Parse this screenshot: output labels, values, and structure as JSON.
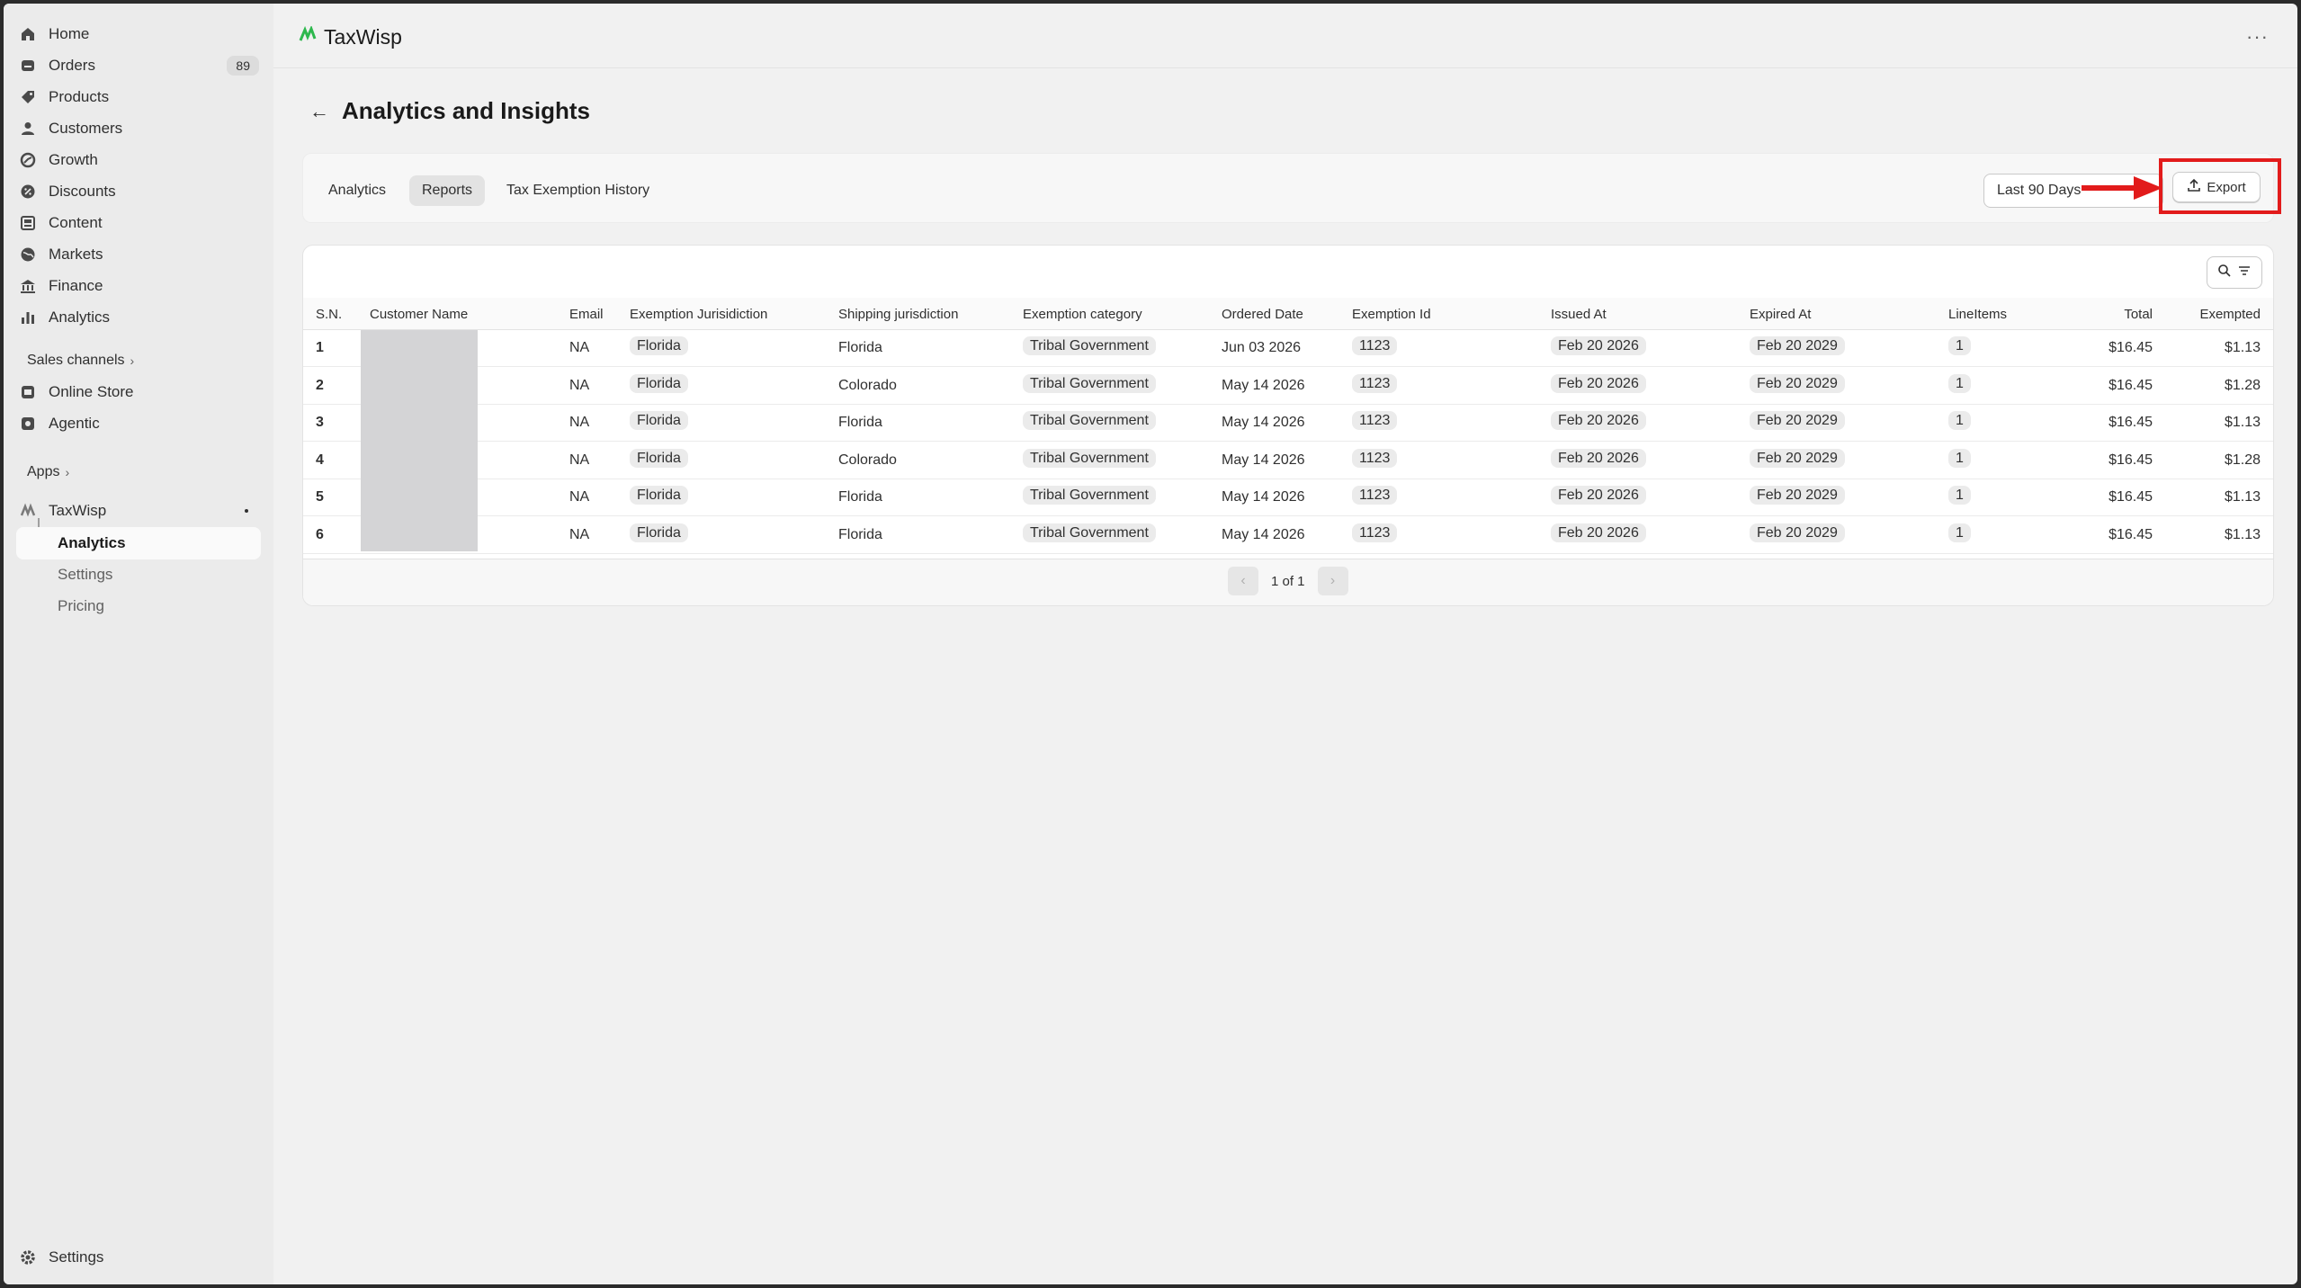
{
  "sidebar": {
    "items": [
      {
        "label": "Home",
        "icon": "home-icon"
      },
      {
        "label": "Orders",
        "icon": "orders-icon",
        "count": "89"
      },
      {
        "label": "Products",
        "icon": "tag-icon"
      },
      {
        "label": "Customers",
        "icon": "person-icon"
      },
      {
        "label": "Growth",
        "icon": "growth-icon"
      },
      {
        "label": "Discounts",
        "icon": "discount-icon"
      },
      {
        "label": "Content",
        "icon": "content-icon"
      },
      {
        "label": "Markets",
        "icon": "globe-icon"
      },
      {
        "label": "Finance",
        "icon": "bank-icon"
      },
      {
        "label": "Analytics",
        "icon": "bar-chart-icon"
      }
    ],
    "sales_channels_label": "Sales channels",
    "channels": [
      {
        "label": "Online Store",
        "icon": "store-icon"
      },
      {
        "label": "Agentic",
        "icon": "agentic-icon"
      }
    ],
    "apps_label": "Apps",
    "app_name": "TaxWisp",
    "app_subitems": [
      "Analytics",
      "Settings",
      "Pricing"
    ],
    "settings_label": "Settings"
  },
  "header": {
    "brand": "TaxWisp",
    "more_label": "···"
  },
  "page": {
    "title": "Analytics and Insights",
    "tabs": [
      "Analytics",
      "Reports",
      "Tax Exemption History"
    ],
    "active_tab": "Reports",
    "date_range": "Last 90 Days",
    "export_label": "Export"
  },
  "table": {
    "columns": [
      "S.N.",
      "Customer Name",
      "Email",
      "Exemption Jurisidiction",
      "Shipping jurisdiction",
      "Exemption category",
      "Ordered Date",
      "Exemption Id",
      "Issued At",
      "Expired At",
      "LineItems",
      "Total",
      "Exempted"
    ],
    "rows": [
      {
        "sn": "1",
        "email": "NA",
        "exemption_jurisdiction": "Florida",
        "shipping": "Florida",
        "category": "Tribal Government",
        "ordered": "Jun 03 2026",
        "exemption_id": "1123",
        "issued": "Feb 20 2026",
        "expired": "Feb 20 2029",
        "line_items": "1",
        "total": "$16.45",
        "exempted": "$1.13"
      },
      {
        "sn": "2",
        "email": "NA",
        "exemption_jurisdiction": "Florida",
        "shipping": "Colorado",
        "category": "Tribal Government",
        "ordered": "May 14 2026",
        "exemption_id": "1123",
        "issued": "Feb 20 2026",
        "expired": "Feb 20 2029",
        "line_items": "1",
        "total": "$16.45",
        "exempted": "$1.28"
      },
      {
        "sn": "3",
        "email": "NA",
        "exemption_jurisdiction": "Florida",
        "shipping": "Florida",
        "category": "Tribal Government",
        "ordered": "May 14 2026",
        "exemption_id": "1123",
        "issued": "Feb 20 2026",
        "expired": "Feb 20 2029",
        "line_items": "1",
        "total": "$16.45",
        "exempted": "$1.13"
      },
      {
        "sn": "4",
        "email": "NA",
        "exemption_jurisdiction": "Florida",
        "shipping": "Colorado",
        "category": "Tribal Government",
        "ordered": "May 14 2026",
        "exemption_id": "1123",
        "issued": "Feb 20 2026",
        "expired": "Feb 20 2029",
        "line_items": "1",
        "total": "$16.45",
        "exempted": "$1.28"
      },
      {
        "sn": "5",
        "email": "NA",
        "exemption_jurisdiction": "Florida",
        "shipping": "Florida",
        "category": "Tribal Government",
        "ordered": "May 14 2026",
        "exemption_id": "1123",
        "issued": "Feb 20 2026",
        "expired": "Feb 20 2029",
        "line_items": "1",
        "total": "$16.45",
        "exempted": "$1.13"
      },
      {
        "sn": "6",
        "email": "NA",
        "exemption_jurisdiction": "Florida",
        "shipping": "Florida",
        "category": "Tribal Government",
        "ordered": "May 14 2026",
        "exemption_id": "1123",
        "issued": "Feb 20 2026",
        "expired": "Feb 20 2029",
        "line_items": "1",
        "total": "$16.45",
        "exempted": "$1.13"
      }
    ],
    "pagination": "1 of 1"
  },
  "colors": {
    "highlight": "#e21b1b",
    "brand_green": "#2db84d"
  }
}
